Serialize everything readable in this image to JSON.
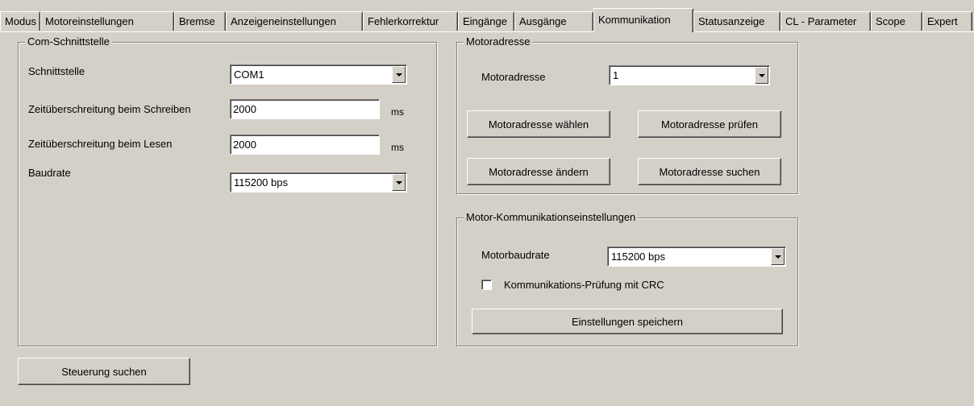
{
  "tabs": [
    {
      "label": "Modus"
    },
    {
      "label": "Motoreinstellungen"
    },
    {
      "label": "Bremse"
    },
    {
      "label": "Anzeigeneinstellungen"
    },
    {
      "label": "Fehlerkorrektur"
    },
    {
      "label": "Eingänge"
    },
    {
      "label": "Ausgänge"
    },
    {
      "label": "Kommunikation",
      "active": true
    },
    {
      "label": "Statusanzeige"
    },
    {
      "label": "CL - Parameter"
    },
    {
      "label": "Scope"
    },
    {
      "label": "Expert"
    }
  ],
  "com": {
    "title": "Com-Schnittstelle",
    "interface_label": "Schnittstelle",
    "interface_value": "COM1",
    "write_timeout_label": "Zeitüberschreitung beim Schreiben",
    "write_timeout_value": "2000",
    "write_timeout_unit": "ms",
    "read_timeout_label": "Zeitüberschreitung beim Lesen",
    "read_timeout_value": "2000",
    "read_timeout_unit": "ms",
    "baudrate_label": "Baudrate",
    "baudrate_value": "115200 bps"
  },
  "motor_address": {
    "title": "Motoradresse",
    "address_label": "Motoradresse",
    "address_value": "1",
    "select_button": "Motoradresse wählen",
    "check_button": "Motoradresse prüfen",
    "change_button": "Motoradresse ändern",
    "search_button": "Motoradresse suchen"
  },
  "motor_comm": {
    "title": "Motor-Kommunikationseinstellungen",
    "baudrate_label": "Motorbaudrate",
    "baudrate_value": "115200 bps",
    "crc_label": "Kommunikations-Prüfung mit CRC",
    "crc_checked": false,
    "save_button": "Einstellungen speichern"
  },
  "search_controller_button": "Steuerung suchen"
}
